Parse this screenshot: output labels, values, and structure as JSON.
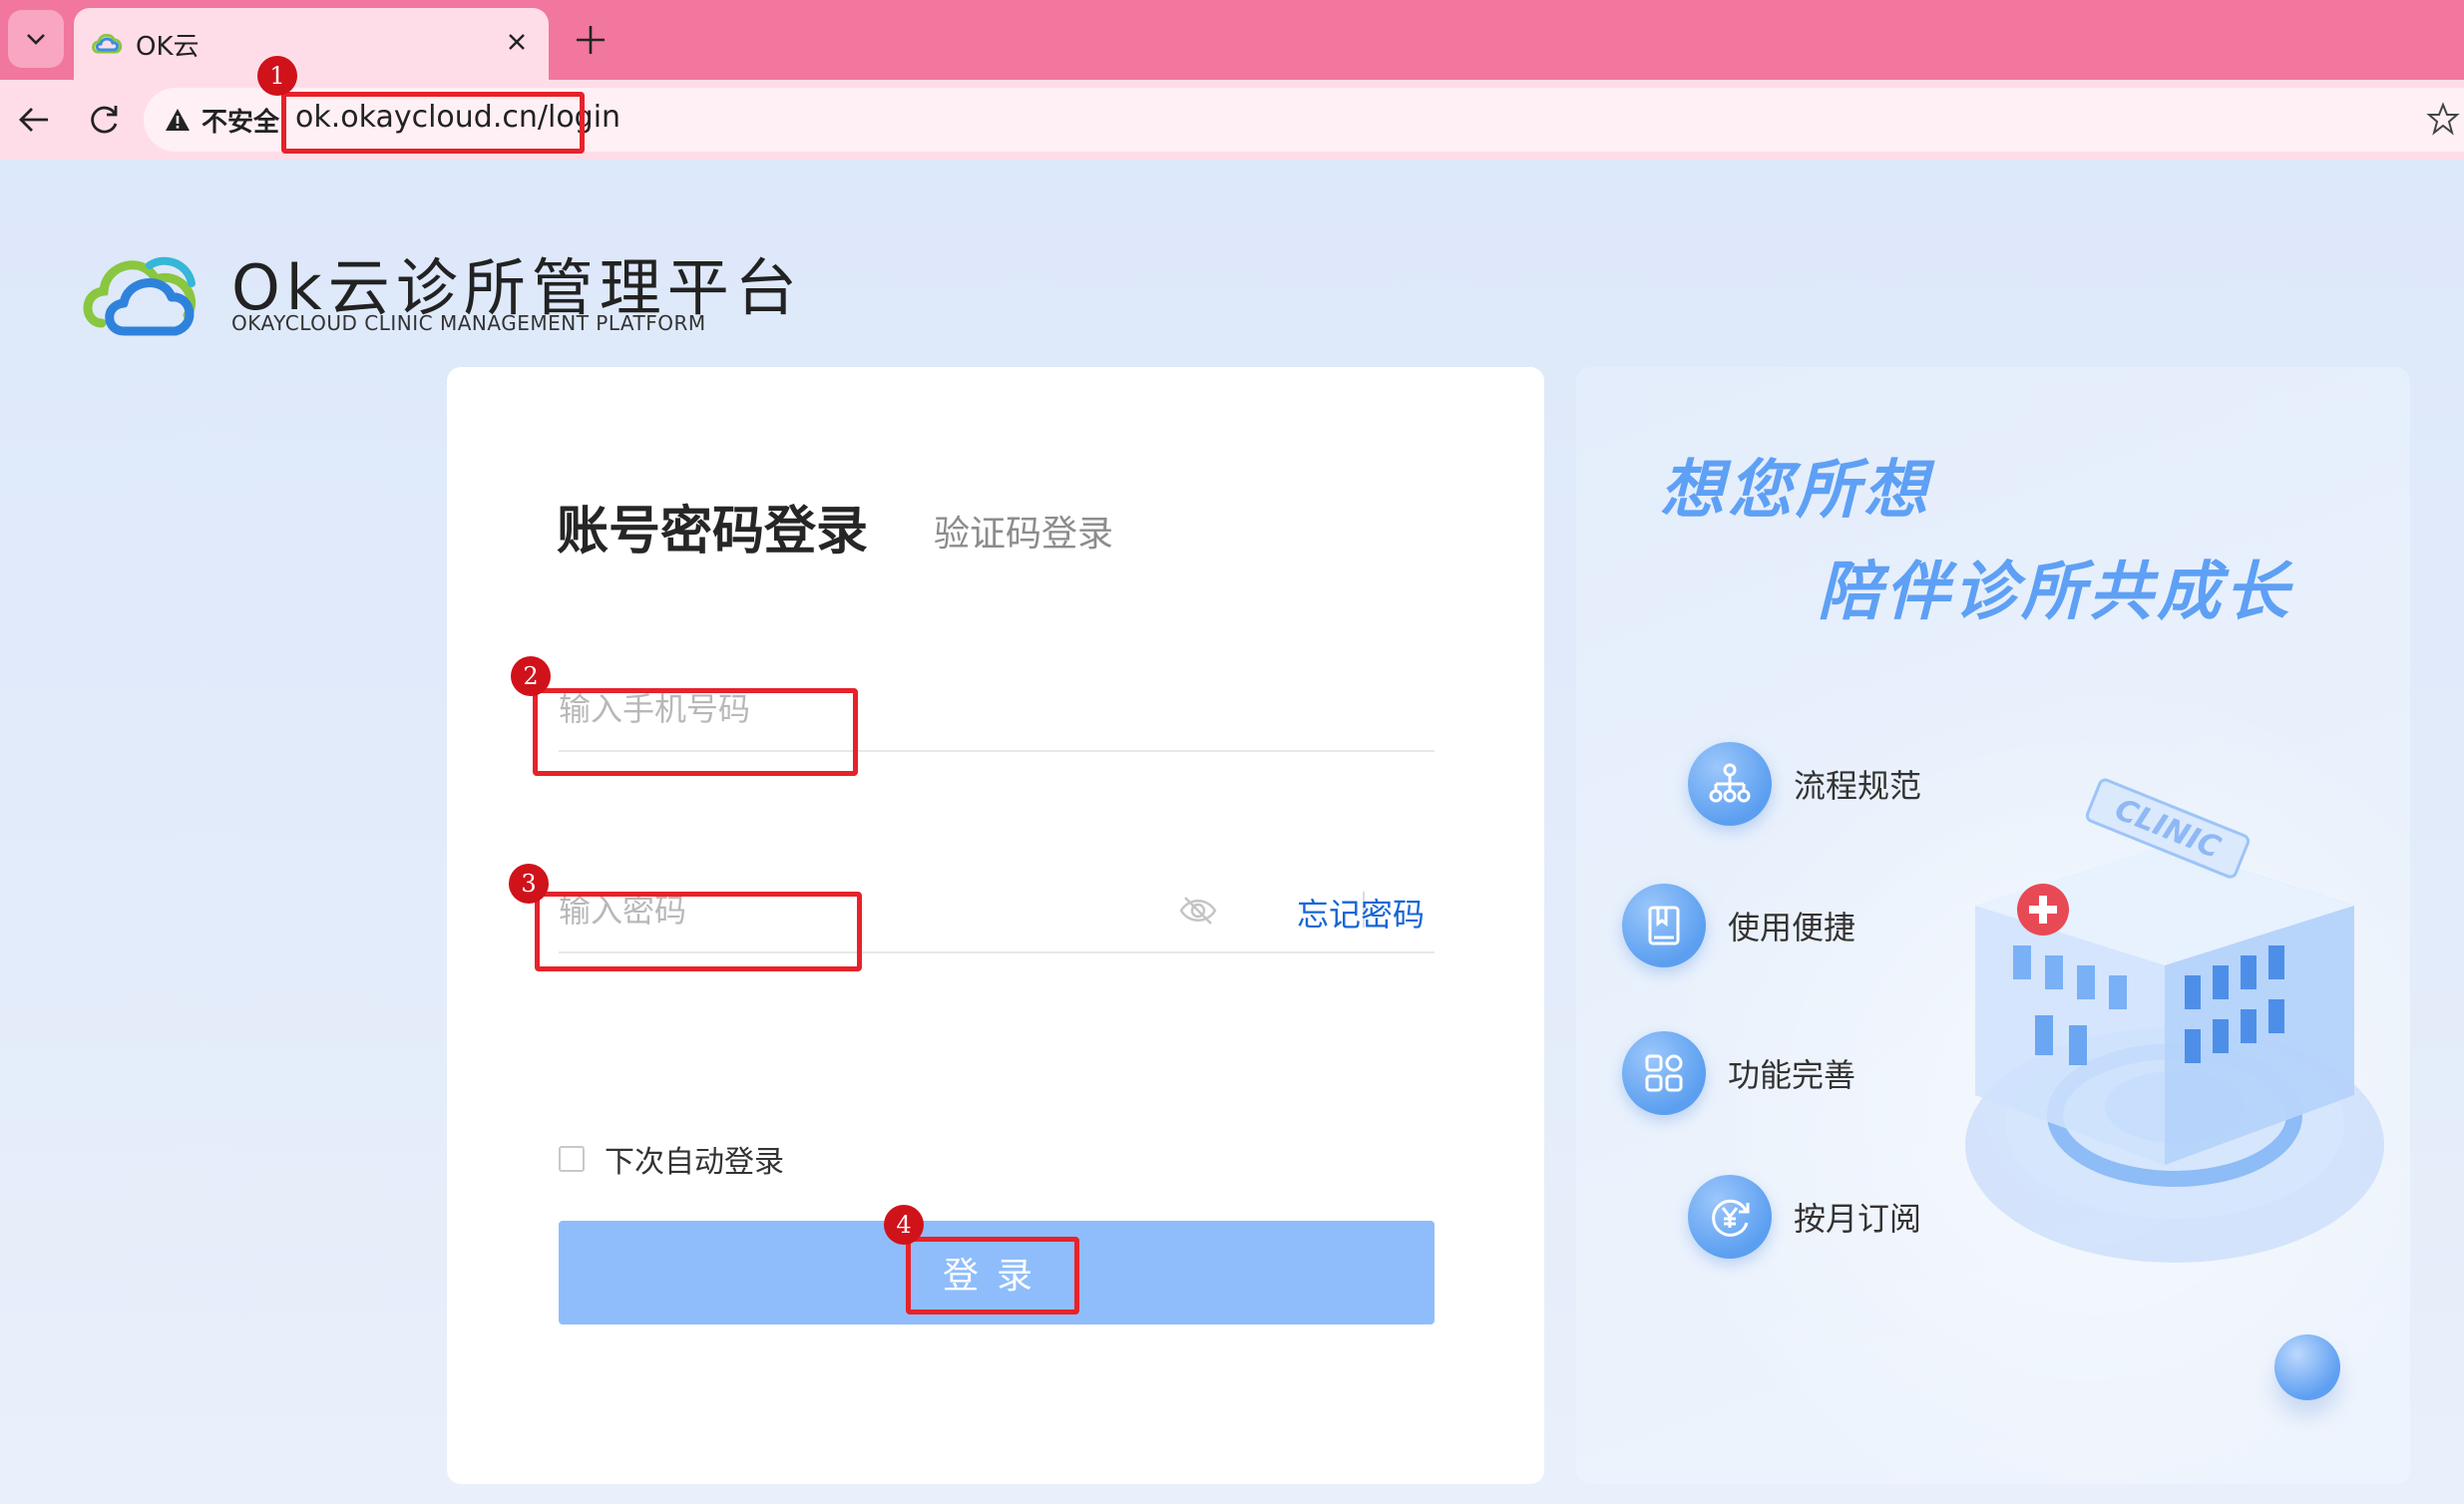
{
  "browser": {
    "tab_title": "OK云",
    "insecure_label": "不安全",
    "url": "ok.okaycloud.cn/login"
  },
  "brand": {
    "title": "Ok云诊所管理平台",
    "subtitle": "OKAYCLOUD CLINIC MANAGEMENT PLATFORM"
  },
  "login": {
    "tab_password": "账号密码登录",
    "tab_code": "验证码登录",
    "phone_placeholder": "输入手机号码",
    "password_placeholder": "输入密码",
    "forgot_label": "忘记密码",
    "remember_label": "下次自动登录",
    "submit_label": "登录"
  },
  "promo": {
    "slogan_line1": "想您所想",
    "slogan_line2": "陪伴诊所共成长",
    "features": [
      {
        "label": "流程规范",
        "icon": "flowchart-icon"
      },
      {
        "label": "使用便捷",
        "icon": "book-icon"
      },
      {
        "label": "功能完善",
        "icon": "grid-icon"
      },
      {
        "label": "按月订阅",
        "icon": "yen-refresh-icon"
      }
    ],
    "building_sign": "CLINIC"
  },
  "annotations": [
    "1",
    "2",
    "3",
    "4"
  ],
  "colors": {
    "tabbar": "#f1779f",
    "toolbar": "#ffdde8",
    "accent_blue": "#1766d6",
    "button_blue": "#8fbdfb",
    "slogan_blue": "#5ea0f5",
    "annotation_red": "#e7222a"
  }
}
